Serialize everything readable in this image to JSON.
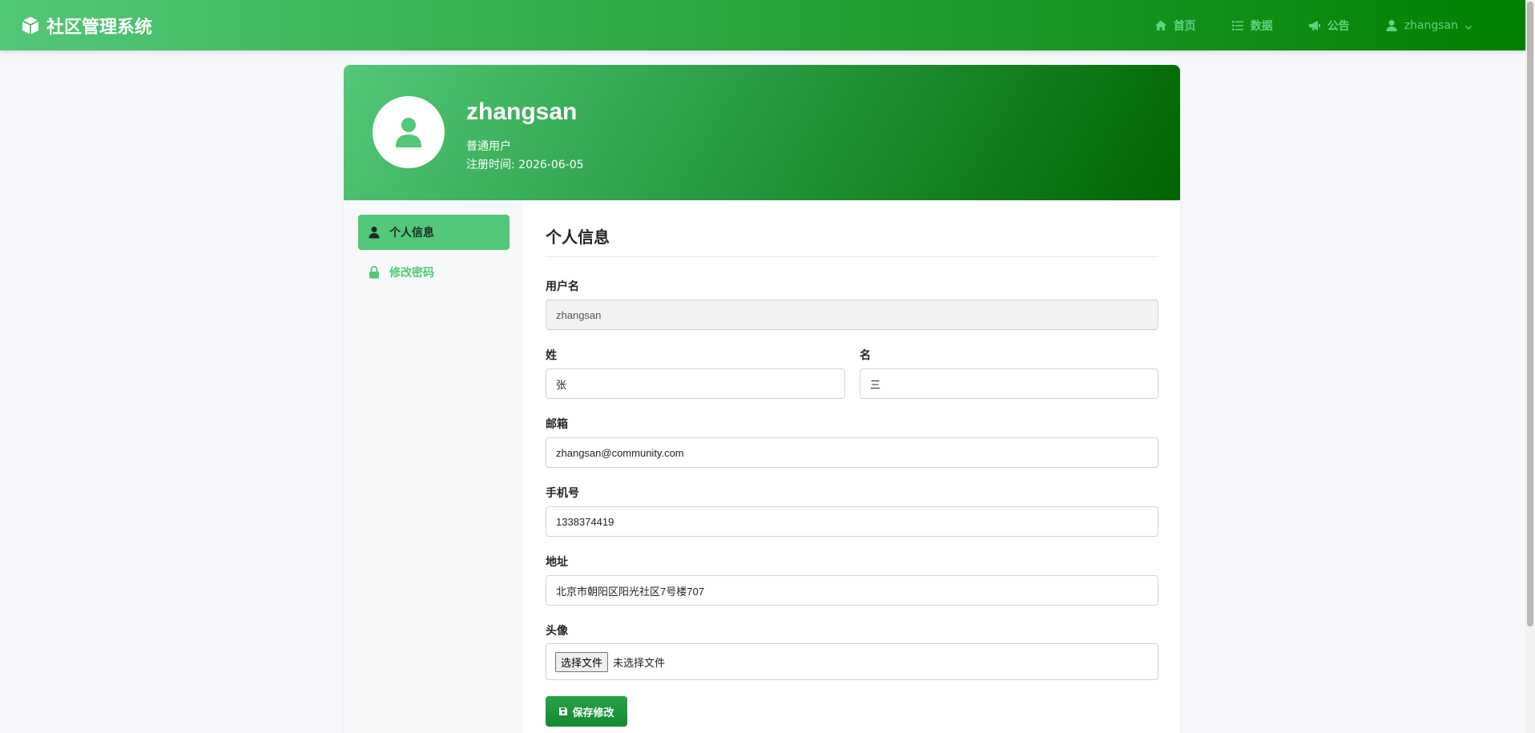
{
  "navbar": {
    "brand": "社区管理系统",
    "brand_icon": "cube-icon",
    "links": [
      {
        "label": "首页",
        "icon": "home-icon"
      },
      {
        "label": "数据",
        "icon": "list-icon"
      },
      {
        "label": "公告",
        "icon": "megaphone-icon"
      },
      {
        "label": "zhangsan",
        "icon": "user-icon"
      }
    ]
  },
  "profile": {
    "username": "zhangsan",
    "role": "普通用户",
    "reg_time": "注册时间: 2026-06-05"
  },
  "sidebar": {
    "items": [
      {
        "label": "个人信息",
        "icon": "user-icon",
        "active": true
      },
      {
        "label": "修改密码",
        "icon": "lock-icon",
        "active": false
      }
    ]
  },
  "form": {
    "title": "个人信息",
    "username_label": "用户名",
    "username_value": "zhangsan",
    "last_name_label": "姓",
    "last_name_value": "张",
    "first_name_label": "名",
    "first_name_value": "三",
    "email_label": "邮箱",
    "email_value": "zhangsan@community.com",
    "phone_label": "手机号",
    "phone_value": "1338374419",
    "address_label": "地址",
    "address_value": "北京市朝阳区阳光社区7号楼707",
    "avatar_label": "头像",
    "file_button": "选择文件",
    "file_status": "未选择文件",
    "save_label": "保存修改"
  },
  "colors": {
    "accent": "#52c878",
    "dark_green": "#006400",
    "save_button": "#1a9438"
  }
}
